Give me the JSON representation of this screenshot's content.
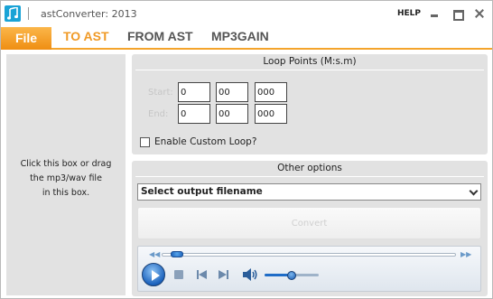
{
  "window": {
    "title": "astConverter: 2013",
    "help_label": "HELP",
    "icon": "music-note-icon",
    "controls": [
      "minimize-icon",
      "maximize-icon",
      "close-icon"
    ]
  },
  "menu": {
    "file_label": "File",
    "tabs": [
      {
        "label": "TO AST",
        "active": true
      },
      {
        "label": "FROM AST",
        "active": false
      },
      {
        "label": "MP3GAIN",
        "active": false
      }
    ]
  },
  "dropzone": {
    "text": "Click this box or drag\nthe mp3/wav file\nin this box."
  },
  "loop_points": {
    "title": "Loop Points (M:s.m)",
    "start_label": "Start:",
    "end_label": "End:",
    "start": {
      "minutes": "0",
      "seconds": "00",
      "millis": "000"
    },
    "end": {
      "minutes": "0",
      "seconds": "00",
      "millis": "000"
    },
    "enable_custom_loop_label": "Enable Custom Loop?",
    "enable_custom_loop_checked": false
  },
  "other_options": {
    "title": "Other options",
    "output_filename_selected": "Select output filename",
    "convert_label": "Convert",
    "convert_enabled": false
  },
  "player": {
    "seek_position": 0.03,
    "volume_level": 0.5,
    "icons": [
      "seek-back-icon",
      "seek-forward-icon",
      "play-icon",
      "stop-icon",
      "previous-icon",
      "next-icon",
      "volume-icon"
    ]
  },
  "colors": {
    "accent": "#f09a26",
    "file_button_top": "#fbb64a",
    "file_button_bottom": "#ef8e12",
    "panel_bg": "#e2e2e2",
    "app_icon": "#1aa3d6",
    "player_blue": "#1b62bd"
  }
}
